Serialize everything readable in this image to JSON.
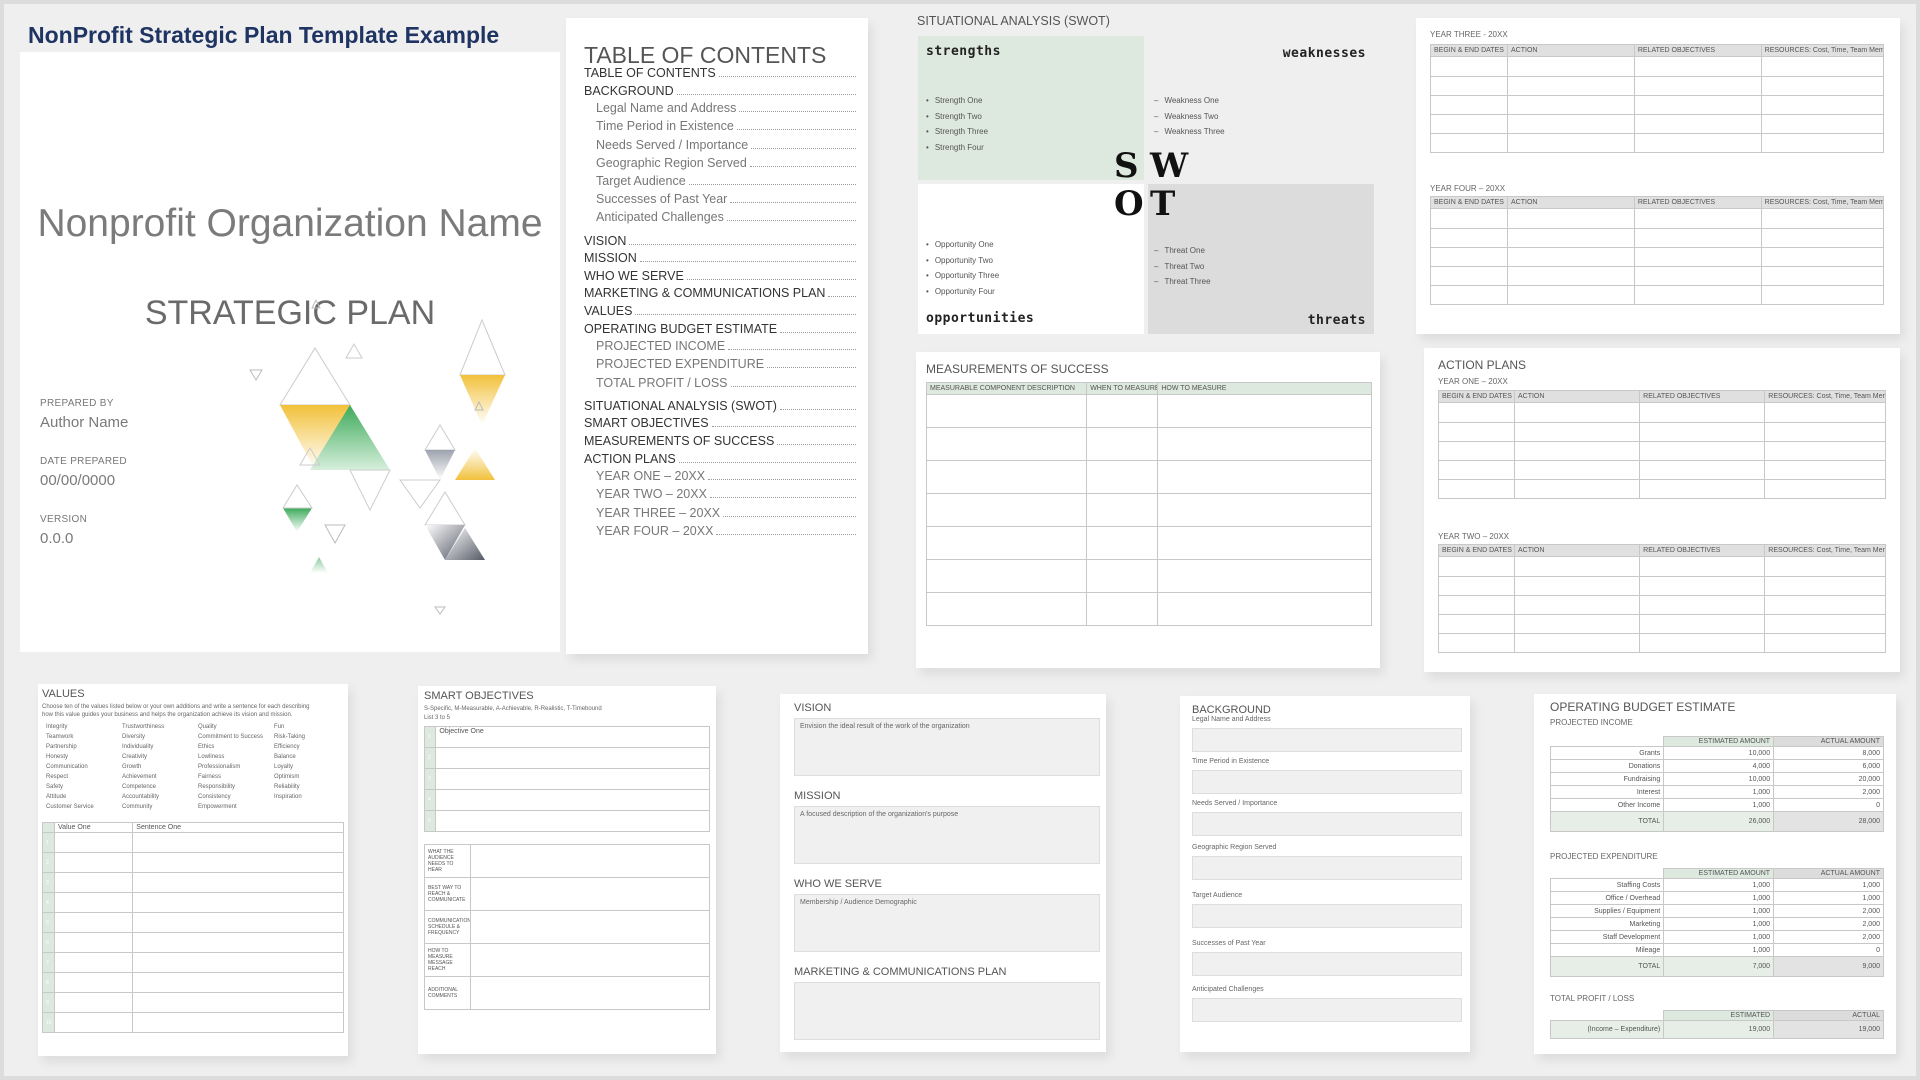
{
  "title": "NonProfit Strategic Plan Template Example",
  "cover": {
    "org_name": "Nonprofit Organization Name",
    "plan_title": "STRATEGIC PLAN",
    "prepared_by_label": "PREPARED BY",
    "prepared_by": "Author Name",
    "date_label": "DATE PREPARED",
    "date": "00/00/0000",
    "version_label": "VERSION",
    "version": "0.0.0"
  },
  "toc": {
    "heading": "TABLE OF CONTENTS",
    "items": [
      {
        "label": "TABLE OF CONTENTS",
        "sub": false
      },
      {
        "label": "BACKGROUND",
        "sub": false
      },
      {
        "label": "Legal Name and Address",
        "sub": true
      },
      {
        "label": "Time Period in Existence",
        "sub": true
      },
      {
        "label": "Needs Served / Importance",
        "sub": true
      },
      {
        "label": "Geographic Region Served",
        "sub": true
      },
      {
        "label": "Target Audience",
        "sub": true
      },
      {
        "label": "Successes of Past Year",
        "sub": true
      },
      {
        "label": "Anticipated Challenges",
        "sub": true
      },
      {
        "label": "VISION",
        "sub": false
      },
      {
        "label": "MISSION",
        "sub": false
      },
      {
        "label": "WHO WE SERVE",
        "sub": false
      },
      {
        "label": "MARKETING & COMMUNICATIONS PLAN",
        "sub": false
      },
      {
        "label": "VALUES",
        "sub": false
      },
      {
        "label": "OPERATING BUDGET ESTIMATE",
        "sub": false
      },
      {
        "label": "PROJECTED INCOME",
        "sub": true
      },
      {
        "label": "PROJECTED EXPENDITURE",
        "sub": true
      },
      {
        "label": "TOTAL PROFIT / LOSS",
        "sub": true
      },
      {
        "label": "SITUATIONAL ANALYSIS (SWOT)",
        "sub": false
      },
      {
        "label": "SMART OBJECTIVES",
        "sub": false
      },
      {
        "label": "MEASUREMENTS OF SUCCESS",
        "sub": false
      },
      {
        "label": "ACTION PLANS",
        "sub": false
      },
      {
        "label": "YEAR ONE  –  20XX",
        "sub": true
      },
      {
        "label": "YEAR TWO  –  20XX",
        "sub": true
      },
      {
        "label": "YEAR THREE  –  20XX",
        "sub": true
      },
      {
        "label": "YEAR FOUR  –  20XX",
        "sub": true
      }
    ]
  },
  "swot": {
    "title": "SITUATIONAL ANALYSIS (SWOT)",
    "strengths": {
      "title": "strengths",
      "items": [
        "Strength One",
        "Strength Two",
        "Strength Three",
        "Strength Four"
      ],
      "color": "#dde8df"
    },
    "weaknesses": {
      "title": "weaknesses",
      "items": [
        "Weakness One",
        "Weakness Two",
        "Weakness Three"
      ],
      "color": "#efefef"
    },
    "opportunities": {
      "title": "opportunities",
      "items": [
        "Opportunity One",
        "Opportunity Two",
        "Opportunity Three",
        "Opportunity Four"
      ],
      "color": "#ffffff"
    },
    "threats": {
      "title": "threats",
      "items": [
        "Threat One",
        "Threat Two",
        "Threat Three"
      ],
      "color": "#dcdcdc"
    },
    "letters": [
      "S",
      "W",
      "O",
      "T"
    ]
  },
  "measurements": {
    "title": "MEASUREMENTS OF SUCCESS",
    "columns": [
      "MEASURABLE COMPONENT DESCRIPTION",
      "WHEN TO MEASURE",
      "HOW TO MEASURE"
    ]
  },
  "action_columns": [
    "BEGIN & END DATES",
    "ACTION",
    "RELATED OBJECTIVES",
    "RESOURCES: Cost, Time, Team Members"
  ],
  "year_three": "YEAR THREE  -  20XX",
  "year_four": "YEAR FOUR  –  20XX",
  "action_plans": {
    "title": "ACTION PLANS",
    "year_one": "YEAR ONE  –  20XX",
    "year_two": "YEAR TWO  –  20XX"
  },
  "values": {
    "title": "VALUES",
    "intro_1": "Choose ten of the values listed below or your own additions and write a sentence for each describing",
    "intro_2": "how this value guides your business and helps the organization achieve its vision and mission.",
    "columns": [
      [
        "Integrity",
        "Teamwork",
        "Partnership",
        "Honesty",
        "Communication",
        "Respect",
        "Safety",
        "Attitude",
        "Customer Service"
      ],
      [
        "Trustworthiness",
        "Diversity",
        "Individuality",
        "Creativity",
        "Growth",
        "Achievement",
        "Competence",
        "Accountability",
        "Community"
      ],
      [
        "Quality",
        "Commitment to Success",
        "Ethics",
        "Lowliness",
        "Professionalism",
        "Fairness",
        "Responsibility",
        "Consistency",
        "Empowerment"
      ],
      [
        "Fun",
        "Risk-Taking",
        "Efficiency",
        "Balance",
        "Loyalty",
        "Optimism",
        "Reliability",
        "Inspiration"
      ]
    ],
    "table_headers": [
      "Value One",
      "Sentence One"
    ],
    "row_numbers": [
      "1",
      "2",
      "3",
      "4",
      "5",
      "6",
      "7",
      "8",
      "9",
      "10"
    ]
  },
  "smart": {
    "title": "SMART OBJECTIVES",
    "legend": "S-Specific, M-Measurable, A-Achievable, R-Realistic, T-Timebound",
    "list_label": "List 3 to 5",
    "objective_one": "Objective One",
    "row_numbers": [
      "1",
      "2",
      "3",
      "4",
      "5"
    ],
    "questions": [
      "WHAT THE AUDIENCE NEEDS TO HEAR",
      "BEST WAY TO REACH & COMMUNICATE",
      "COMMUNICATION SCHEDULE & FREQUENCY",
      "HOW TO MEASURE MESSAGE REACH",
      "ADDITIONAL COMMENTS"
    ]
  },
  "vision_page": {
    "vision": "VISION",
    "vision_text": "Envision the ideal result of the work of the organization",
    "mission": "MISSION",
    "mission_text": "A focused description of the organization's purpose",
    "who": "WHO WE SERVE",
    "who_text": "Membership / Audience Demographic",
    "marketing": "MARKETING & COMMUNICATIONS PLAN"
  },
  "background_page": {
    "title": "BACKGROUND",
    "fields": [
      "Legal Name and Address",
      "Time Period in Existence",
      "Needs Served / Importance",
      "Geographic Region Served",
      "Target Audience",
      "Successes of Past Year",
      "Anticipated Challenges"
    ]
  },
  "budget": {
    "title": "OPERATING BUDGET ESTIMATE",
    "income_title": "PROJECTED INCOME",
    "col_est": "ESTIMATED AMOUNT",
    "col_act": "ACTUAL AMOUNT",
    "income": [
      {
        "label": "Grants",
        "est": "10,000",
        "act": "8,000"
      },
      {
        "label": "Donations",
        "est": "4,000",
        "act": "6,000"
      },
      {
        "label": "Fundraising",
        "est": "10,000",
        "act": "20,000"
      },
      {
        "label": "Interest",
        "est": "1,000",
        "act": "2,000"
      },
      {
        "label": "Other Income",
        "est": "1,000",
        "act": "0"
      }
    ],
    "total_label": "TOTAL",
    "income_total_est": "26,000",
    "income_total_act": "28,000",
    "exp_title": "PROJECTED EXPENDITURE",
    "expenditure": [
      {
        "label": "Staffing Costs",
        "est": "1,000",
        "act": "1,000"
      },
      {
        "label": "Office / Overhead",
        "est": "1,000",
        "act": "1,000"
      },
      {
        "label": "Supplies / Equipment",
        "est": "1,000",
        "act": "2,000"
      },
      {
        "label": "Marketing",
        "est": "1,000",
        "act": "2,000"
      },
      {
        "label": "Staff Development",
        "est": "1,000",
        "act": "2,000"
      },
      {
        "label": "Mileage",
        "est": "1,000",
        "act": "0"
      }
    ],
    "exp_total_est": "7,000",
    "exp_total_act": "9,000",
    "pl_title": "TOTAL PROFIT / LOSS",
    "pl_col_est": "ESTIMATED",
    "pl_col_act": "ACTUAL",
    "pl_label": "(Income – Expenditure)",
    "pl_est": "19,000",
    "pl_act": "19,000"
  },
  "colors": {
    "title_navy": "#1f3463",
    "sage": "#dde8df",
    "green": "#3daa5a",
    "yellow": "#f2c13b",
    "grey": "#6e7078"
  }
}
